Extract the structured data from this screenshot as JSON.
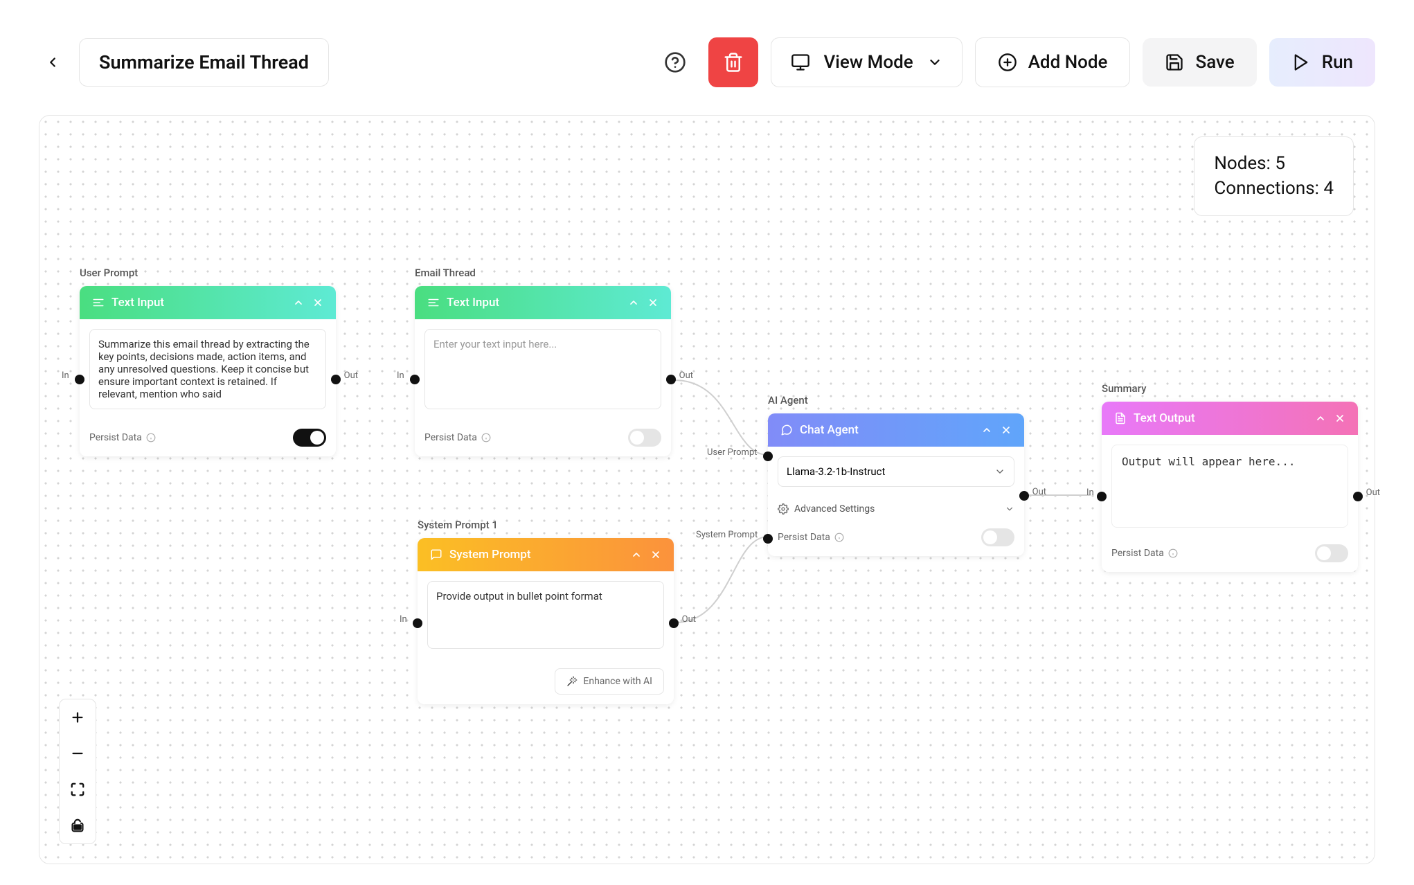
{
  "header": {
    "title": "Summarize Email Thread",
    "view_mode_label": "View Mode",
    "add_node_label": "Add Node",
    "save_label": "Save",
    "run_label": "Run"
  },
  "stats": {
    "nodes_label": "Nodes:",
    "nodes_count": "5",
    "connections_label": "Connections:",
    "connections_count": "4"
  },
  "nodes": {
    "user_prompt": {
      "title": "User Prompt",
      "header": "Text Input",
      "content": "Summarize this email thread by extracting the key points, decisions made, action items, and any unresolved questions. Keep it concise but ensure important context is retained. If relevant, mention who said",
      "persist_label": "Persist Data",
      "persist_on": true,
      "in_label": "In",
      "out_label": "Out"
    },
    "email_thread": {
      "title": "Email Thread",
      "header": "Text Input",
      "placeholder": "Enter your text input here...",
      "persist_label": "Persist Data",
      "persist_on": false,
      "in_label": "In",
      "out_label": "Out"
    },
    "system_prompt": {
      "title": "System Prompt 1",
      "header": "System Prompt",
      "content": "Provide output in bullet point format",
      "enhance_label": "Enhance with AI",
      "in_label": "In",
      "out_label": "Out"
    },
    "ai_agent": {
      "title": "AI Agent",
      "header": "Chat Agent",
      "model": "Llama-3.2-1b-Instruct",
      "adv_label": "Advanced Settings",
      "persist_label": "Persist Data",
      "persist_on": false,
      "user_prompt_label": "User Prompt",
      "system_prompt_label": "System Prompt",
      "out_label": "Out"
    },
    "summary": {
      "title": "Summary",
      "header": "Text Output",
      "output_text": "Output will appear here...",
      "persist_label": "Persist Data",
      "persist_on": false,
      "in_label": "In",
      "out_label": "Out"
    }
  }
}
